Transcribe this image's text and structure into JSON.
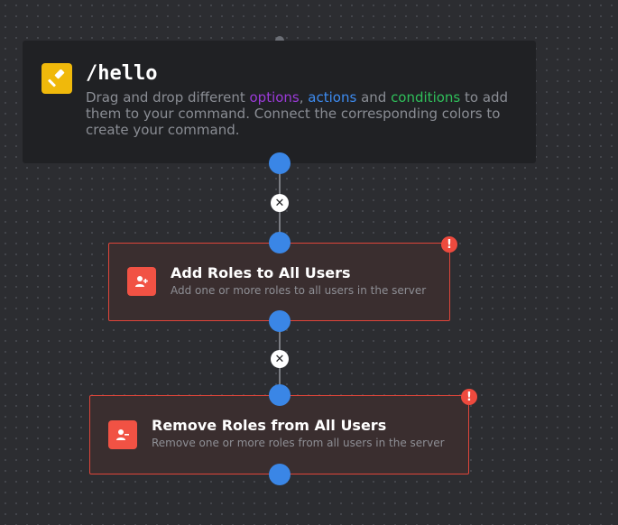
{
  "root": {
    "title": "/hello",
    "desc_prefix": "Drag and drop different ",
    "word_options": "options",
    "sep1": ", ",
    "word_actions": "actions",
    "sep2": " and ",
    "word_conditions": "conditions",
    "desc_suffix": " to add them to your command. Connect the corresponding colors to create your command.",
    "icon": "hammer-icon"
  },
  "blocks": [
    {
      "title": "Add Roles to All Users",
      "description": "Add one or more roles to all users in the server",
      "icon": "user-plus-icon",
      "warning": "!"
    },
    {
      "title": "Remove Roles from All Users",
      "description": "Remove one or more roles from all users in the server",
      "icon": "user-minus-icon",
      "warning": "!"
    }
  ],
  "connectors": [
    {
      "delete_label": "✕"
    },
    {
      "delete_label": "✕"
    }
  ],
  "colors": {
    "background": "#2c2d31",
    "root_block": "#202124",
    "command_icon": "#f0b90b",
    "options": "#9b3ad8",
    "actions": "#3d8bf0",
    "conditions": "#2fbf5a",
    "action_border": "#e0453a",
    "action_icon": "#f15244",
    "port": "#3a86e6",
    "warning": "#ee4a3e"
  }
}
